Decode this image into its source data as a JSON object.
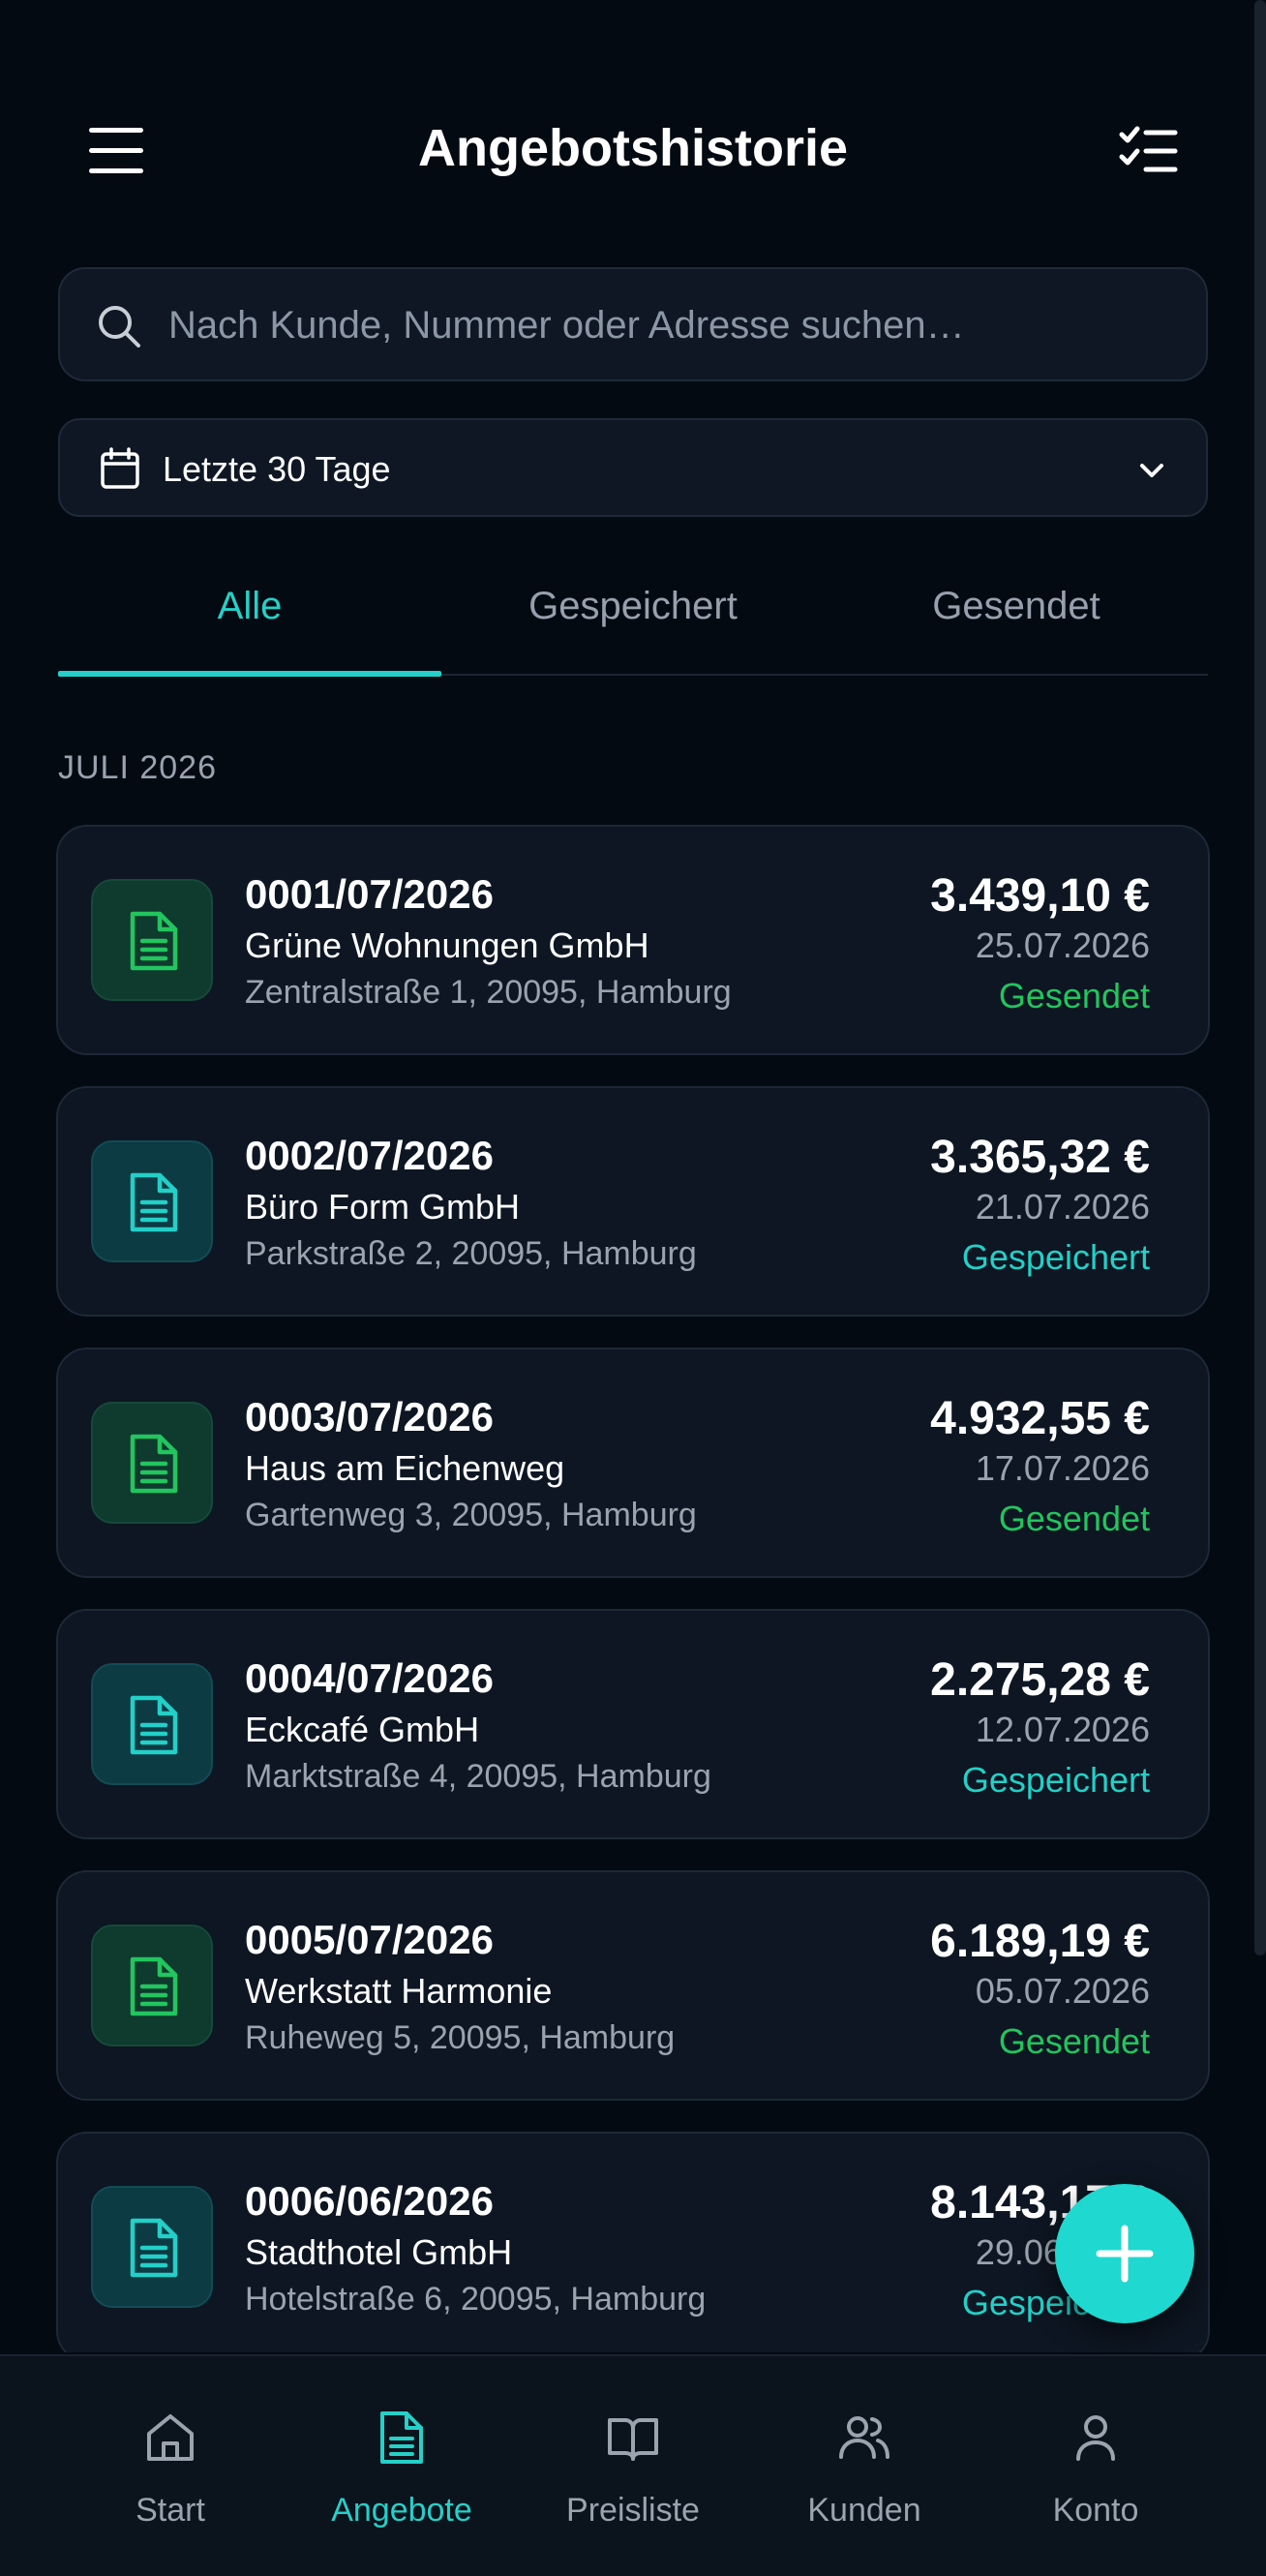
{
  "header": {
    "title": "Angebotshistorie",
    "menu_icon": "hamburger-menu-icon",
    "select_icon": "checklist-icon"
  },
  "search": {
    "placeholder": "Nach Kunde, Nummer oder Adresse suchen…",
    "value": ""
  },
  "filter": {
    "selected": "Letzte 30 Tage"
  },
  "tabs": [
    {
      "label": "Alle",
      "active": true
    },
    {
      "label": "Gespeichert",
      "active": false
    },
    {
      "label": "Gesendet",
      "active": false
    }
  ],
  "section": {
    "label": "JULI 2026"
  },
  "offers": [
    {
      "number": "0001/07/2026",
      "customer": "Grüne Wohnungen GmbH",
      "address": "Zentralstraße 1, 20095, Hamburg",
      "amount": "3.439,10 €",
      "date": "25.07.2026",
      "status": "Gesendet",
      "status_type": "sent"
    },
    {
      "number": "0002/07/2026",
      "customer": "Büro Form GmbH",
      "address": "Parkstraße 2, 20095, Hamburg",
      "amount": "3.365,32 €",
      "date": "21.07.2026",
      "status": "Gespeichert",
      "status_type": "saved"
    },
    {
      "number": "0003/07/2026",
      "customer": "Haus am Eichenweg",
      "address": "Gartenweg 3, 20095, Hamburg",
      "amount": "4.932,55 €",
      "date": "17.07.2026",
      "status": "Gesendet",
      "status_type": "sent"
    },
    {
      "number": "0004/07/2026",
      "customer": "Eckcafé GmbH",
      "address": "Marktstraße 4, 20095, Hamburg",
      "amount": "2.275,28 €",
      "date": "12.07.2026",
      "status": "Gespeichert",
      "status_type": "saved"
    },
    {
      "number": "0005/07/2026",
      "customer": "Werkstatt Harmonie",
      "address": "Ruheweg 5, 20095, Hamburg",
      "amount": "6.189,19 €",
      "date": "05.07.2026",
      "status": "Gesendet",
      "status_type": "sent"
    },
    {
      "number": "0006/06/2026",
      "customer": "Stadthotel GmbH",
      "address": "Hotelstraße 6, 20095, Hamburg",
      "amount": "8.143,17 €",
      "date": "29.06.2026",
      "status": "Gespeichert",
      "status_type": "saved"
    }
  ],
  "nav": [
    {
      "label": "Start",
      "icon": "home-icon",
      "active": false
    },
    {
      "label": "Angebote",
      "icon": "document-icon",
      "active": true
    },
    {
      "label": "Preisliste",
      "icon": "book-icon",
      "active": false
    },
    {
      "label": "Kunden",
      "icon": "users-icon",
      "active": false
    },
    {
      "label": "Konto",
      "icon": "user-icon",
      "active": false
    }
  ],
  "colors": {
    "background": "#040a12",
    "card": "#0d1622",
    "accent": "#25d0c8",
    "sent": "#22c55e",
    "saved": "#22d0c8",
    "fab": "#1fd8d0"
  }
}
